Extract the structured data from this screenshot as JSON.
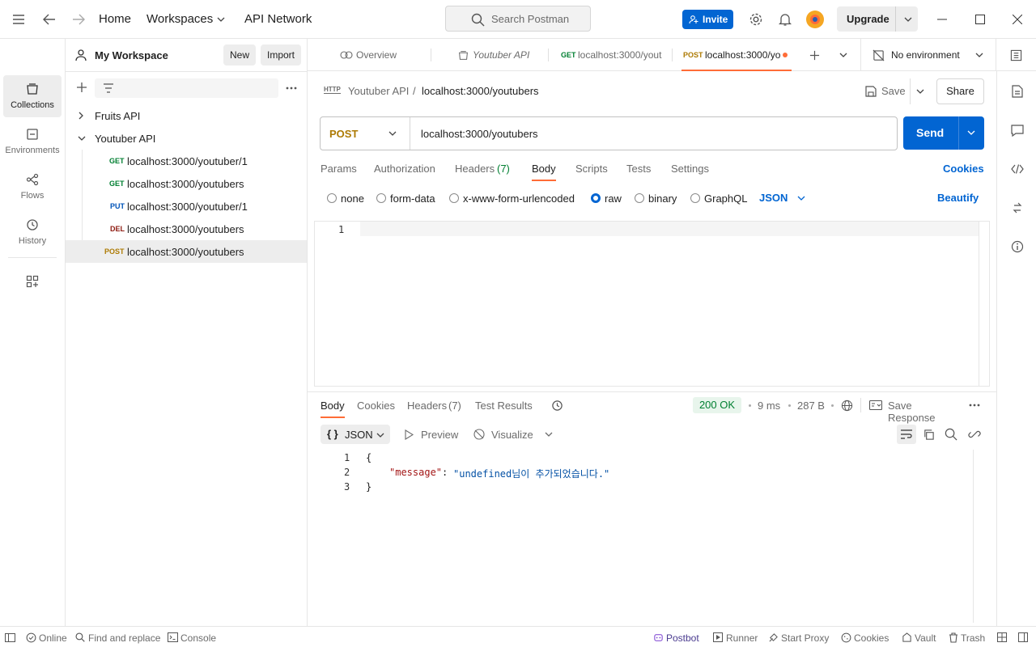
{
  "titlebar": {
    "nav": {
      "home": "Home",
      "workspaces": "Workspaces",
      "api_network": "API Network"
    },
    "search_placeholder": "Search Postman",
    "invite_label": "Invite",
    "upgrade_label": "Upgrade"
  },
  "rail": {
    "items": [
      {
        "label": "Collections",
        "icon": "collections-icon"
      },
      {
        "label": "Environments",
        "icon": "environments-icon"
      },
      {
        "label": "Flows",
        "icon": "flows-icon"
      },
      {
        "label": "History",
        "icon": "history-icon"
      }
    ]
  },
  "sidebar": {
    "workspace_name": "My Workspace",
    "new_label": "New",
    "import_label": "Import",
    "collections": [
      {
        "name": "Fruits API"
      },
      {
        "name": "Youtuber API"
      }
    ],
    "requests": [
      {
        "method": "GET",
        "url": "localhost:3000/youtuber/1",
        "color": "#007f31"
      },
      {
        "method": "GET",
        "url": "localhost:3000/youtubers",
        "color": "#007f31"
      },
      {
        "method": "PUT",
        "url": "localhost:3000/youtuber/1",
        "color": "#0053b8"
      },
      {
        "method": "DEL",
        "url": "localhost:3000/youtubers",
        "color": "#8e1a10"
      },
      {
        "method": "POST",
        "url": "localhost:3000/youtubers",
        "color": "#ad7a03"
      }
    ]
  },
  "tabs": {
    "overview": "Overview",
    "collection": "Youtuber API",
    "tab_get_method": "GET",
    "tab_get_url": "localhost:3000/yout",
    "tab_post_method": "POST",
    "tab_post_url": "localhost:3000/yo",
    "environment": "No environment"
  },
  "request": {
    "breadcrumb_parent": "Youtuber API",
    "breadcrumb_sep": "/",
    "breadcrumb_current": "localhost:3000/youtubers",
    "save_label": "Save",
    "share_label": "Share",
    "method": "POST",
    "url": "localhost:3000/youtubers",
    "send_label": "Send",
    "subtabs": {
      "params": "Params",
      "authorization": "Authorization",
      "headers": "Headers",
      "headers_count": "(7)",
      "body": "Body",
      "scripts": "Scripts",
      "tests": "Tests",
      "settings": "Settings",
      "cookies": "Cookies"
    },
    "body_types": {
      "none": "none",
      "form_data": "form-data",
      "urlencoded": "x-www-form-urlencoded",
      "raw": "raw",
      "binary": "binary",
      "graphql": "GraphQL",
      "format": "JSON",
      "beautify": "Beautify"
    },
    "editor_line": "1"
  },
  "response": {
    "tabs": {
      "body": "Body",
      "cookies": "Cookies",
      "headers": "Headers",
      "headers_count": "(7)",
      "test_results": "Test Results"
    },
    "status": "200 OK",
    "time": "9 ms",
    "size": "287 B",
    "save_response": "Save Response",
    "format": "JSON",
    "format_braces": "{ }",
    "preview": "Preview",
    "visualize": "Visualize",
    "lines": [
      "1",
      "2",
      "3"
    ],
    "json_open": "{",
    "json_key": "\"message\"",
    "json_colon": ":",
    "json_value": "\"undefined님이 추가되었습니다.\"",
    "json_close": "}"
  },
  "statusbar": {
    "online": "Online",
    "find_replace": "Find and replace",
    "console": "Console",
    "postbot": "Postbot",
    "runner": "Runner",
    "start_proxy": "Start Proxy",
    "cookies": "Cookies",
    "vault": "Vault",
    "trash": "Trash"
  },
  "colors": {
    "accent": "#0265d2",
    "active_tab_underline": "#ff6c37",
    "status_ok_bg": "#e8f5ec",
    "status_ok_text": "#007f31"
  }
}
